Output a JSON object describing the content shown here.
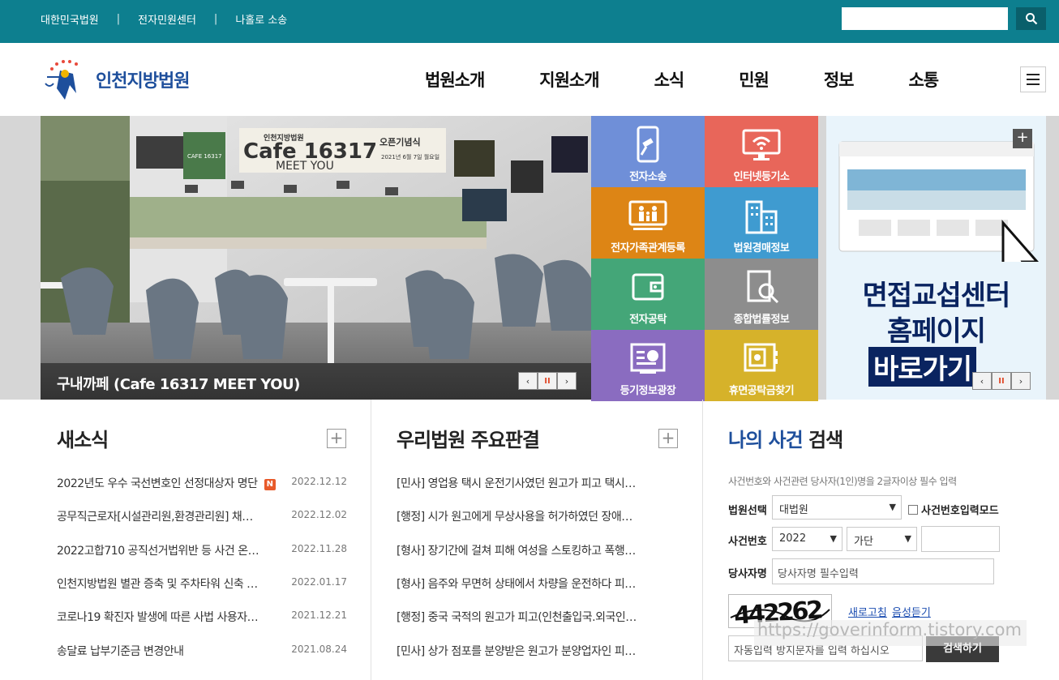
{
  "topbar": {
    "links": [
      "대한민국법원",
      "전자민원센터",
      "나홀로 소송"
    ],
    "separator": "|",
    "search_placeholder": ""
  },
  "header": {
    "logo_text": "인천지방법원",
    "nav": [
      "법원소개",
      "지원소개",
      "소식",
      "민원",
      "정보",
      "소통"
    ]
  },
  "hero": {
    "caption": "구내까페 (Cafe 16317 MEET YOU)",
    "sign_main": "Cafe 16317",
    "sign_sub": "MEET YOU",
    "sign_top": "인천지방법원",
    "sign_right": "오픈기념식",
    "sign_date": "2021년 6월 7일 월요일",
    "cup_label": "CAFE 16317"
  },
  "tiles": [
    {
      "label": "전자소송",
      "color": "#6f8fd8",
      "icon": "mobile-gavel-icon"
    },
    {
      "label": "인터넷등기소",
      "color": "#e8665a",
      "icon": "monitor-wifi-icon"
    },
    {
      "label": "전자가족관계등록",
      "color": "#dd8515",
      "icon": "family-monitor-icon"
    },
    {
      "label": "법원경매정보",
      "color": "#3f9bd0",
      "icon": "buildings-icon"
    },
    {
      "label": "전자공탁",
      "color": "#44a678",
      "icon": "wallet-icon"
    },
    {
      "label": "종합법률정보",
      "color": "#8d8d8d",
      "icon": "book-search-icon"
    },
    {
      "label": "등기정보광장",
      "color": "#8a6cc0",
      "icon": "chart-board-icon"
    },
    {
      "label": "휴면공탁금찾기",
      "color": "#d6b22a",
      "icon": "safe-icon"
    }
  ],
  "promo": {
    "line1": "면접교섭센터",
    "line2": "홈페이지",
    "line3": "바로가기"
  },
  "controls": {
    "prev": "‹",
    "pause": "II",
    "next": "›"
  },
  "news": {
    "title": "새소식",
    "more": "+",
    "badge": "N",
    "items": [
      {
        "title": "2022년도 우수 국선변호인 선정대상자 명단",
        "date": "2022.12.12"
      },
      {
        "title": "공무직근로자[시설관리원,환경관리원] 채…",
        "date": "2022.12.02"
      },
      {
        "title": "2022고합710 공직선거법위반 등 사건 온…",
        "date": "2022.11.28"
      },
      {
        "title": "인천지방법원 별관 증축 및 주차타워 신축 …",
        "date": "2022.01.17"
      },
      {
        "title": "코로나19 확진자 발생에 따른 사법 사용자…",
        "date": "2021.12.21"
      },
      {
        "title": "송달료 납부기준금 변경안내",
        "date": "2021.08.24"
      }
    ]
  },
  "judgments": {
    "title": "우리법원 주요판결",
    "more": "+",
    "items": [
      "[민사] 영업용 택시 운전기사였던 원고가 피고 택시…",
      "[행정] 시가 원고에게 무상사용을 허가하였던 장애…",
      "[형사] 장기간에 걸쳐 피해 여성을 스토킹하고 폭행…",
      "[형사] 음주와 무면허 상태에서 차량을 운전하다 피…",
      "[행정] 중국 국적의 원고가 피고(인천출입국.외국인…",
      "[민사] 상가 점포를 분양받은 원고가 분양업자인 피…"
    ]
  },
  "case_search": {
    "title_part1": "나의 사건",
    "title_part2": "검색",
    "hint": "사건번호와 사건관련 당사자(1인)명을 2글자이상 필수 입력",
    "court_label": "법원선택",
    "court_value": "대법원",
    "direct_mode_label": "사건번호입력모드",
    "case_no_label": "사건번호",
    "year_value": "2022",
    "type_value": "가단",
    "case_no_value": "",
    "party_label": "당사자명",
    "party_placeholder": "당사자명 필수입력",
    "captcha_text": "442262",
    "refresh_label": "새로고침",
    "audio_label": "음성듣기",
    "captcha_placeholder": "자동입력 방지문자를 입력 하십시오",
    "submit_label": "검색하기",
    "watermark": "https://goverinform.tistory.com"
  },
  "colors": {
    "topbar": "#0d7f8f",
    "brand_blue": "#1e4f9c",
    "promo_navy": "#0a2460"
  }
}
